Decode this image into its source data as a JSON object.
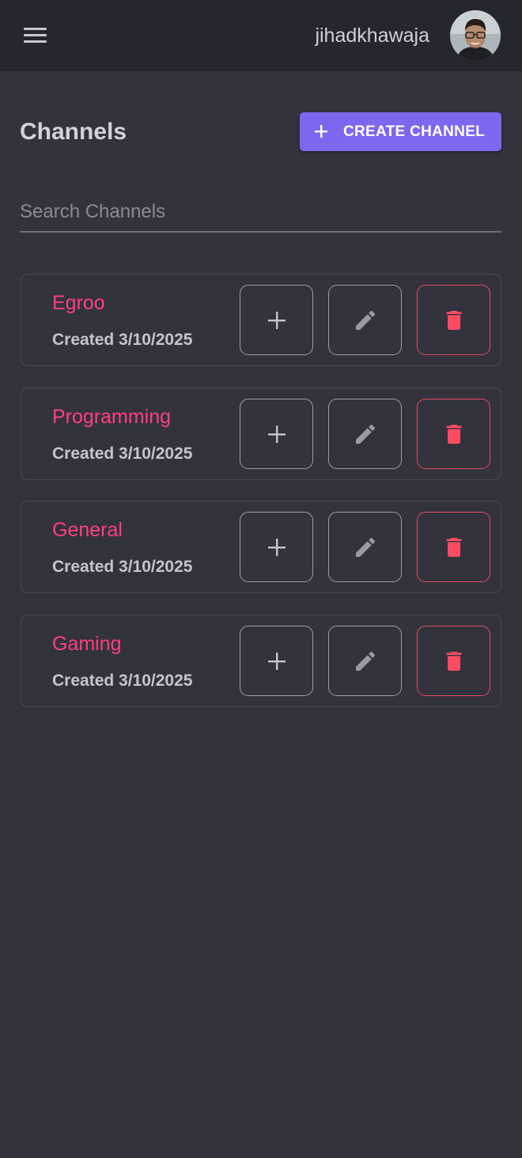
{
  "header": {
    "username": "jihadkhawaja",
    "menu_icon": "menu-icon",
    "avatar_icon": "avatar"
  },
  "page": {
    "title": "Channels",
    "create_button_label": "CREATE CHANNEL",
    "create_button_icon": "plus-icon"
  },
  "search": {
    "placeholder": "Search Channels",
    "value": ""
  },
  "channels": [
    {
      "name": "Egroo",
      "created": "Created 3/10/2025"
    },
    {
      "name": "Programming",
      "created": "Created 3/10/2025"
    },
    {
      "name": "General",
      "created": "Created 3/10/2025"
    },
    {
      "name": "Gaming",
      "created": "Created 3/10/2025"
    }
  ],
  "colors": {
    "background": "#33333d",
    "topbar": "#26262e",
    "accent": "#7b68ee",
    "channel_name": "#ff3f7f",
    "danger": "#e8485e"
  }
}
